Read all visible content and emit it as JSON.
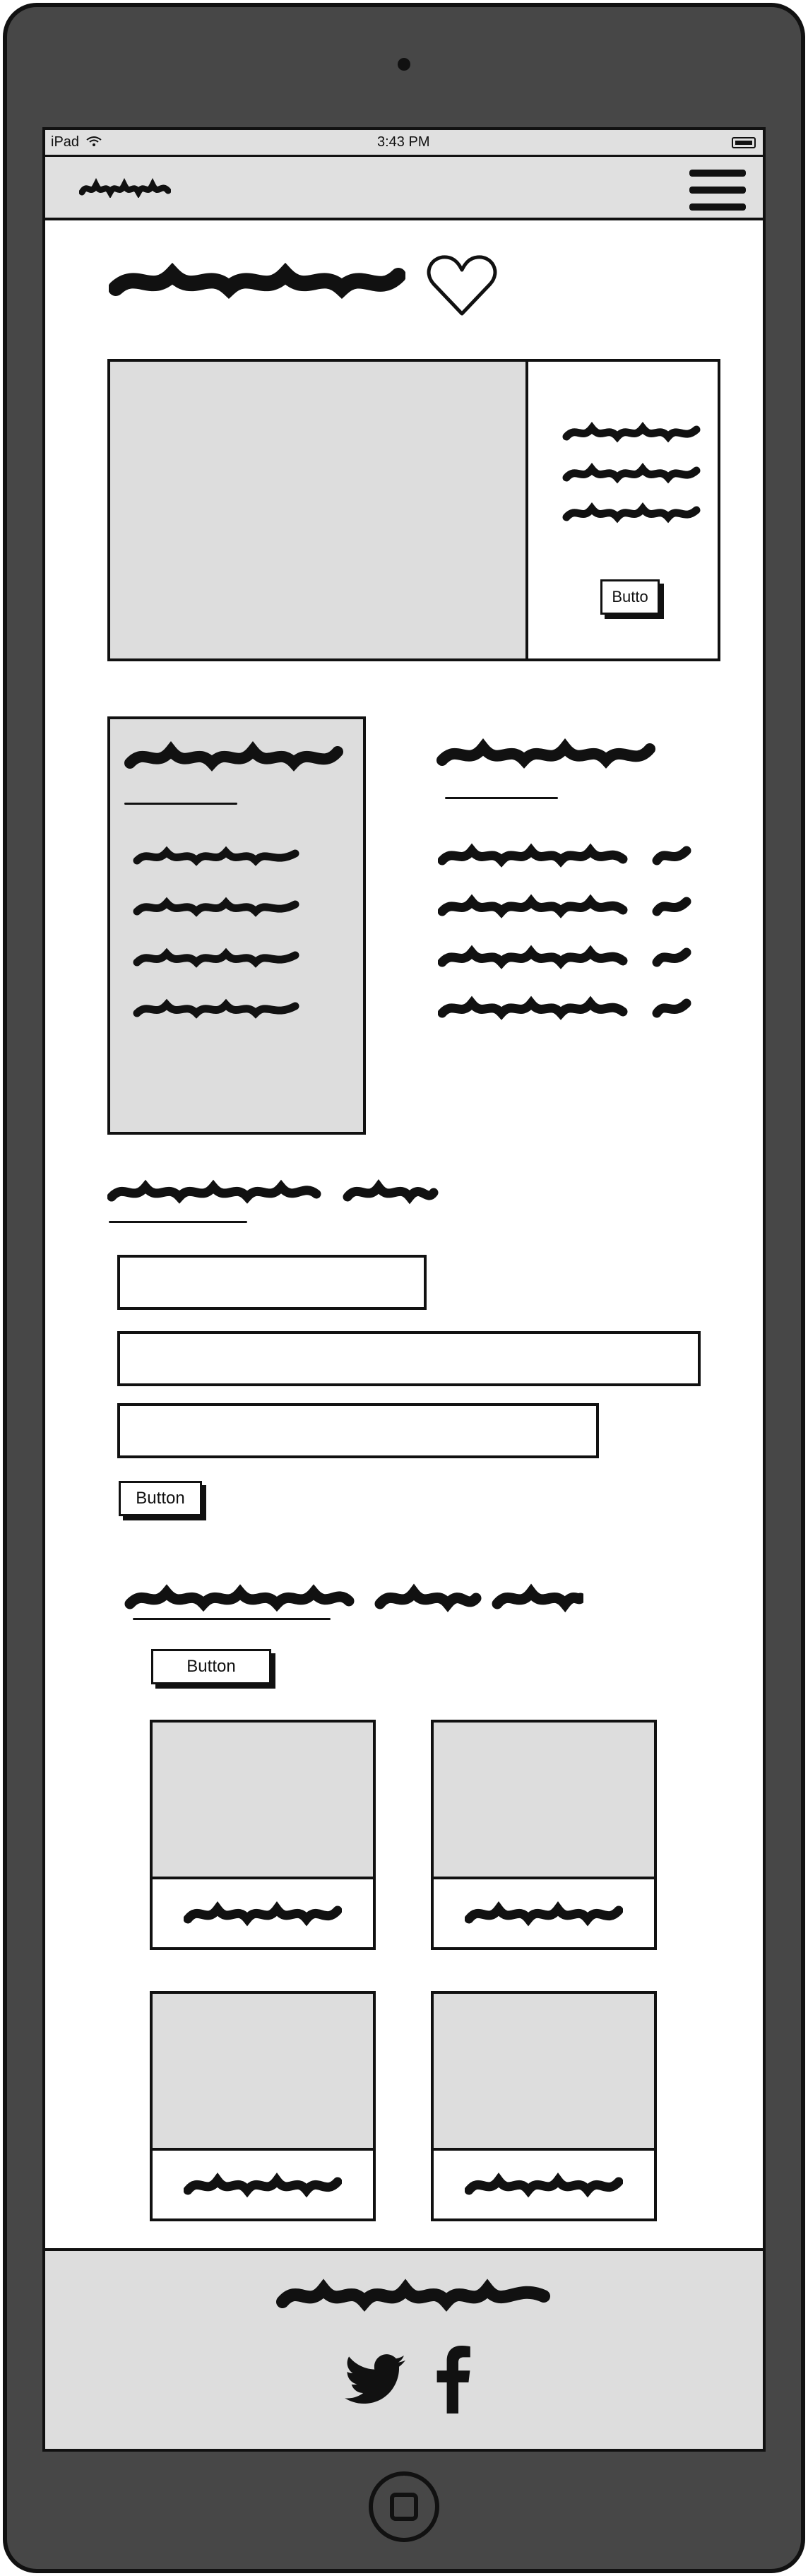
{
  "status_bar": {
    "device": "iPad",
    "time": "3:43 PM"
  },
  "icons": {
    "wifi": "wifi-icon",
    "battery": "battery-icon",
    "menu": "hamburger-menu-icon",
    "favorite": "heart-icon",
    "social": [
      "twitter-icon",
      "facebook-icon"
    ]
  },
  "hero": {
    "button_label": "Butto"
  },
  "form": {
    "submit_label": "Button"
  },
  "gallery": {
    "button_label": "Button",
    "cards": 4
  }
}
